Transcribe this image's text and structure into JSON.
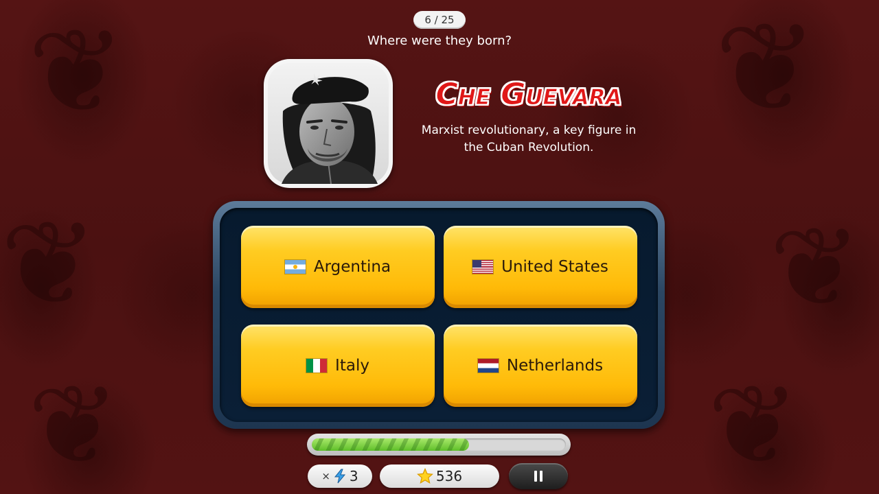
{
  "header": {
    "question_counter": "6 / 25",
    "question": "Where were they born?"
  },
  "person": {
    "name": "Che Guevara",
    "description_line1": "Marxist revolutionary, a key figure in",
    "description_line2": "the Cuban Revolution."
  },
  "answers": [
    {
      "label": "Argentina",
      "flag_icon": "argentina-flag-icon"
    },
    {
      "label": "United States",
      "flag_icon": "united-states-flag-icon"
    },
    {
      "label": "Italy",
      "flag_icon": "italy-flag-icon"
    },
    {
      "label": "Netherlands",
      "flag_icon": "netherlands-flag-icon"
    }
  ],
  "progress": {
    "fraction": 0.62
  },
  "footer": {
    "boost_prefix": "×",
    "boost_count": "3",
    "boost_icon": "lightning-icon",
    "score": "536",
    "score_icon": "star-icon",
    "pause_icon": "pause-icon"
  },
  "colors": {
    "background": "#4a1010",
    "name_red": "#e01818",
    "answer_yellow": "#ffc11a",
    "panel_navy": "#0a1f36",
    "progress_green": "#6cc733"
  }
}
